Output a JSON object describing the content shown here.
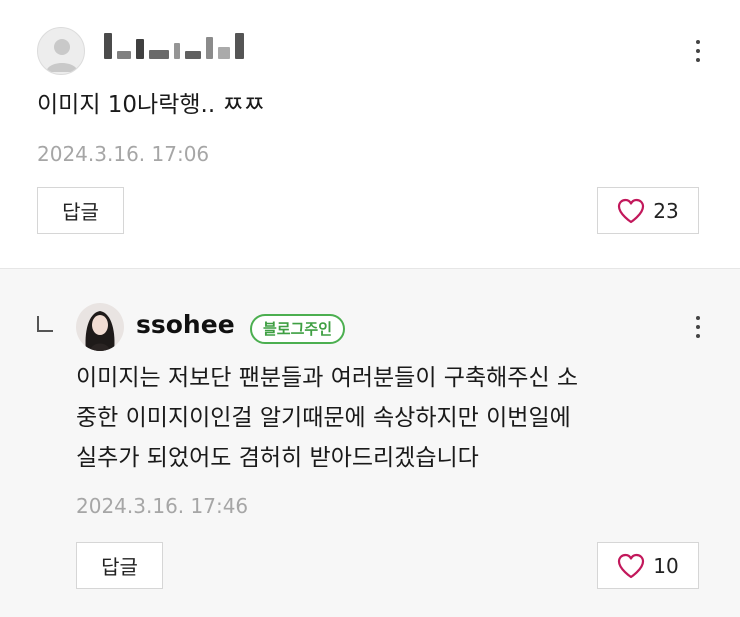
{
  "top_comment": {
    "text": "이미지 10나락행.. ㅉㅉ",
    "date": "2024.3.16. 17:06",
    "reply_label": "답글",
    "like_count": "23"
  },
  "reply_comment": {
    "author": "ssohee",
    "badge": "블로그주인",
    "text": "이미지는 저보단 팬분들과 여러분들이 구축해주신 소\n중한 이미지이인걸 알기때문에 속상하지만 이번일에\n실추가 되었어도 겸허히 받아드리겠습니다",
    "date": "2024.3.16. 17:46",
    "reply_label": "답글",
    "like_count": "10"
  },
  "colors": {
    "heart": "#c2185b",
    "badge": "#4caf50",
    "date": "#a6a6a6"
  },
  "icons": {
    "more": "more-vertical-icon",
    "like": "heart-outline-icon",
    "reply_arrow": "reply-corner-arrow-icon"
  }
}
